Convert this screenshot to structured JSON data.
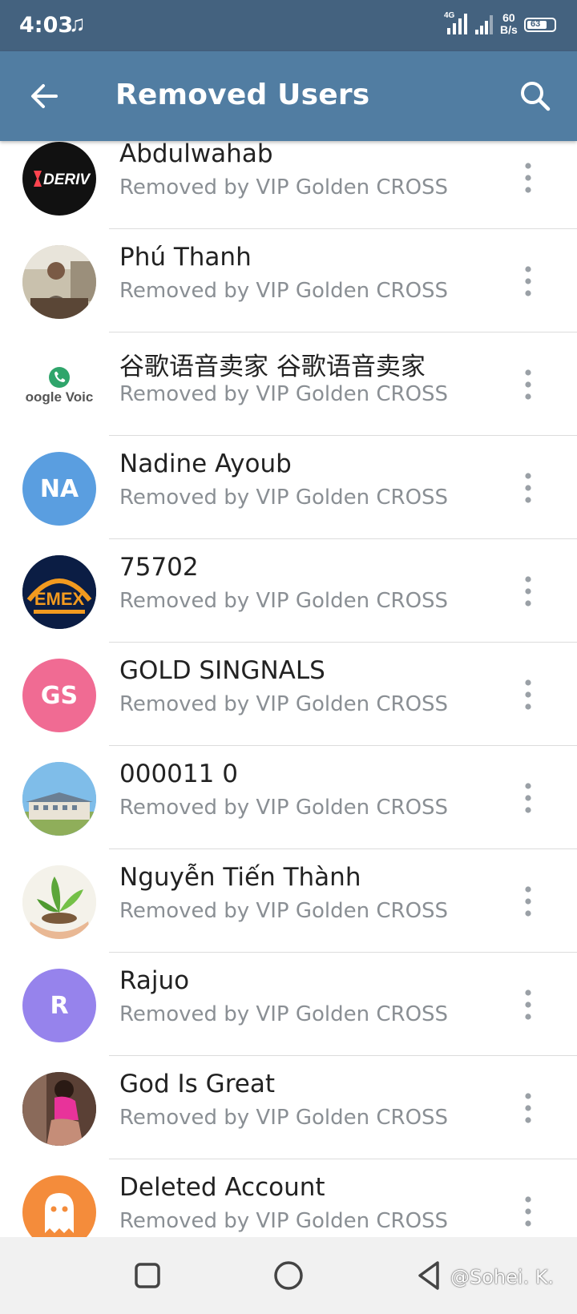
{
  "status_bar": {
    "time": "4:03",
    "network": "4G",
    "speed_value": "60",
    "speed_unit": "B/s",
    "battery": "63"
  },
  "app_bar": {
    "title": "Removed Users",
    "back_icon": "arrow-left-icon",
    "search_icon": "search-icon"
  },
  "colors": {
    "status_bar": "#44627f",
    "app_bar": "#517da2",
    "avatar_blue": "#5a9ee0",
    "avatar_pink": "#f06b93",
    "avatar_purple": "#9683ec",
    "avatar_orange": "#f48c3b"
  },
  "users": [
    {
      "name": "Abdulwahab",
      "subtitle": "Removed by VIP Golden CROSS",
      "avatar_text": "DERIV"
    },
    {
      "name": "Phú Thanh",
      "subtitle": "Removed by VIP Golden CROSS",
      "avatar_text": ""
    },
    {
      "name": "谷歌语音卖家 谷歌语音卖家",
      "subtitle": "Removed by VIP Golden CROSS",
      "avatar_text": "oogle Voic"
    },
    {
      "name": "Nadine Ayoub",
      "subtitle": "Removed by VIP Golden CROSS",
      "avatar_text": "NA"
    },
    {
      "name": "75702",
      "subtitle": "Removed by VIP Golden CROSS",
      "avatar_text": "EMEX"
    },
    {
      "name": "GOLD SINGNALS",
      "subtitle": "Removed by VIP Golden CROSS",
      "avatar_text": "GS"
    },
    {
      "name": "000011 0",
      "subtitle": "Removed by VIP Golden CROSS",
      "avatar_text": ""
    },
    {
      "name": "Nguyễn Tiến Thành",
      "subtitle": "Removed by VIP Golden CROSS",
      "avatar_text": ""
    },
    {
      "name": "Rajuo",
      "subtitle": "Removed by VIP Golden CROSS",
      "avatar_text": "R"
    },
    {
      "name": "God Is Great",
      "subtitle": "Removed by VIP Golden CROSS",
      "avatar_text": ""
    },
    {
      "name": "Deleted Account",
      "subtitle": "Removed by VIP Golden CROSS",
      "avatar_text": ""
    }
  ],
  "watermark": "@Sohei. K."
}
